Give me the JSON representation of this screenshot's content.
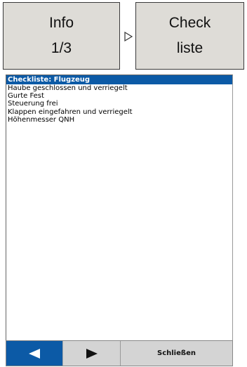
{
  "top_buttons": {
    "info": {
      "line1": "Info",
      "line2": "1/3"
    },
    "check": {
      "line1": "Check",
      "line2": "liste"
    }
  },
  "checklist": {
    "title": "Checkliste: Flugzeug",
    "items": [
      "Haube geschlossen und verriegelt",
      "Gurte Fest",
      "Steuerung frei",
      "Klappen eingefahren und verriegelt",
      "Höhenmesser QNH"
    ]
  },
  "bottom_bar": {
    "close_label": "Schließen"
  },
  "icons": {
    "separator": "triangle-right-outline-icon",
    "prev": "triangle-left-icon",
    "next": "triangle-right-icon"
  },
  "colors": {
    "accent": "#0c5aa6",
    "button_bg": "#dedcd7"
  }
}
